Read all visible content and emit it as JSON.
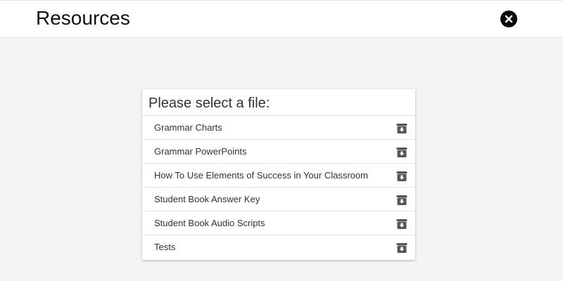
{
  "header": {
    "title": "Resources",
    "close_icon": "close-circle-icon"
  },
  "panel": {
    "heading": "Please select a file:",
    "download_icon": "download-box-icon",
    "files": [
      {
        "label": "Grammar Charts"
      },
      {
        "label": "Grammar PowerPoints"
      },
      {
        "label": "How To Use Elements of Success in Your Classroom"
      },
      {
        "label": "Student Book Answer Key"
      },
      {
        "label": "Student Book Audio Scripts"
      },
      {
        "label": "Tests"
      }
    ]
  },
  "colors": {
    "background": "#f4f4f4",
    "header_background": "#ffffff",
    "icon": "#555555",
    "close_button": "#0a0a0a"
  }
}
